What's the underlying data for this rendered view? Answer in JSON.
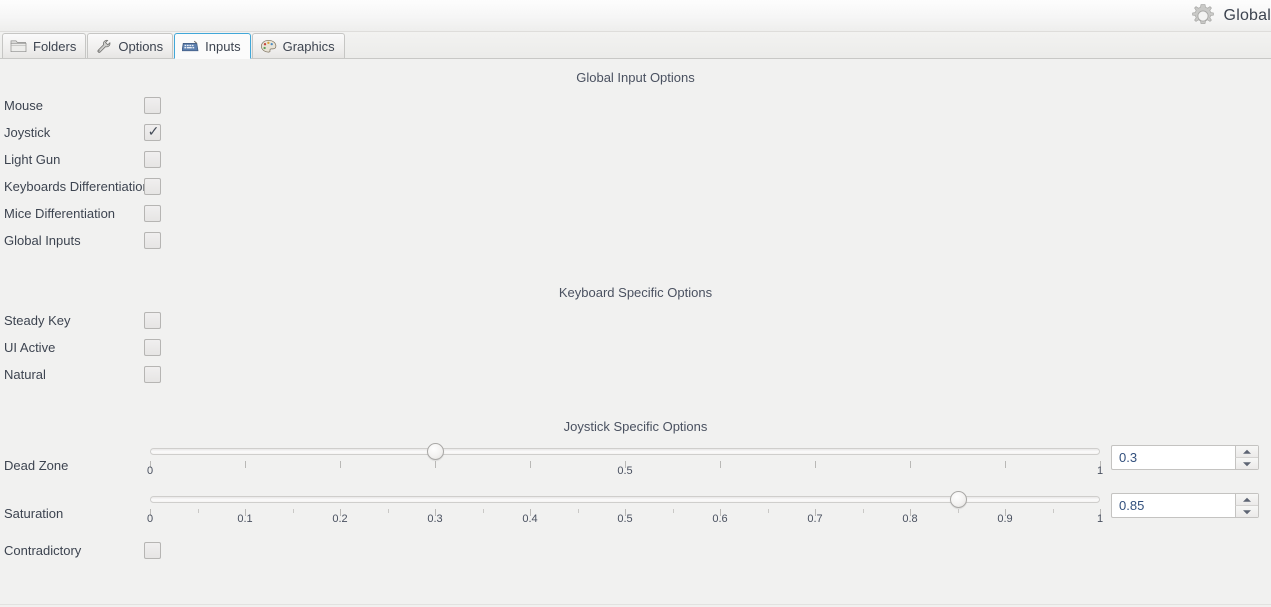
{
  "titlebar": {
    "app_label": "Global",
    "icon": "gear-icon"
  },
  "tabs": [
    {
      "label": "Folders",
      "icon": "folder-icon",
      "active": false
    },
    {
      "label": "Options",
      "icon": "wrench-icon",
      "active": false
    },
    {
      "label": "Inputs",
      "icon": "keyboard-icon",
      "active": true
    },
    {
      "label": "Graphics",
      "icon": "palette-icon",
      "active": false
    }
  ],
  "sections": {
    "global": {
      "heading": "Global Input Options",
      "items": [
        {
          "label": "Mouse",
          "checked": false
        },
        {
          "label": "Joystick",
          "checked": true
        },
        {
          "label": "Light Gun",
          "checked": false
        },
        {
          "label": "Keyboards Differentiation",
          "checked": false
        },
        {
          "label": "Mice Differentiation",
          "checked": false
        },
        {
          "label": "Global Inputs",
          "checked": false
        }
      ]
    },
    "keyboard": {
      "heading": "Keyboard Specific Options",
      "items": [
        {
          "label": "Steady Key",
          "checked": false
        },
        {
          "label": "UI Active",
          "checked": false
        },
        {
          "label": "Natural",
          "checked": false
        }
      ]
    },
    "joystick": {
      "heading": "Joystick Specific Options",
      "sliders": [
        {
          "label": "Dead Zone",
          "value": 0.3,
          "value_text": "0.3",
          "min": 0,
          "max": 1,
          "tick_labels": [
            "0",
            "0.5",
            "1"
          ],
          "tick_label_values": [
            0,
            0.5,
            1
          ],
          "major_tick_step": 0.1,
          "minor_tick_step": 0.1
        },
        {
          "label": "Saturation",
          "value": 0.85,
          "value_text": "0.85",
          "min": 0,
          "max": 1,
          "tick_labels": [
            "0",
            "0.1",
            "0.2",
            "0.3",
            "0.4",
            "0.5",
            "0.6",
            "0.7",
            "0.8",
            "0.9",
            "1"
          ],
          "tick_label_values": [
            0,
            0.1,
            0.2,
            0.3,
            0.4,
            0.5,
            0.6,
            0.7,
            0.8,
            0.9,
            1
          ],
          "major_tick_step": 0.1,
          "minor_tick_step": 0.05
        }
      ],
      "checkboxes": [
        {
          "label": "Contradictory",
          "checked": false
        }
      ]
    }
  },
  "colors": {
    "background": "#f1f1f0",
    "text": "#3d4450",
    "active_tab_border": "#41a7d8",
    "spin_value_text": "#32507d"
  },
  "spinners": {
    "up_icon": "triangle-up-icon",
    "down_icon": "triangle-down-icon"
  }
}
